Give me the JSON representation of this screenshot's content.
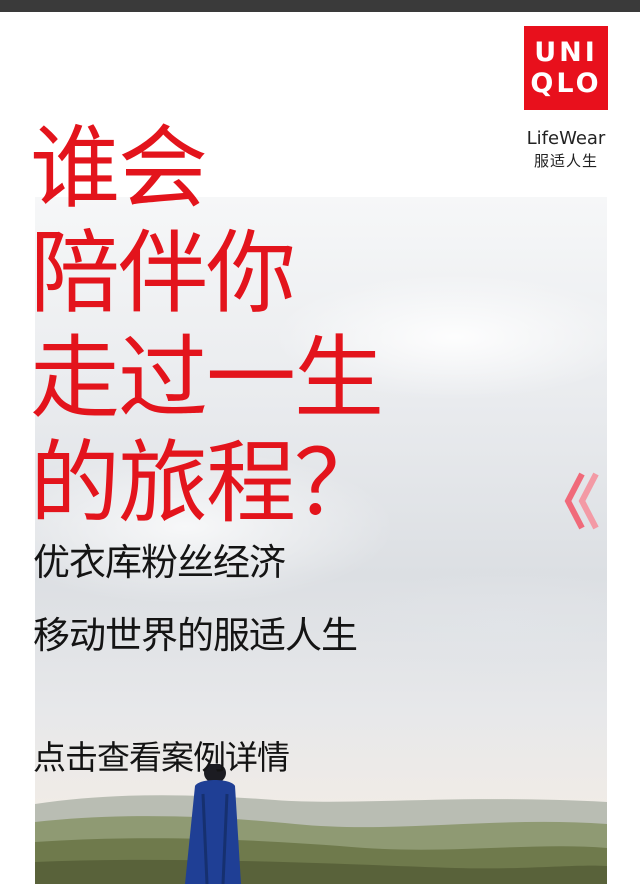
{
  "brand": {
    "logo_line1": "UNI",
    "logo_line2": "QLO",
    "tagline_en": "LifeWear",
    "tagline_cn": "服适人生"
  },
  "headline": {
    "line1": "谁会",
    "line2": "陪伴你",
    "line3": "走过一生",
    "line4": "的旅程？"
  },
  "subtitle": {
    "line1": "优衣库粉丝经济",
    "line2": "移动世界的服适人生"
  },
  "cta": {
    "label": "点击查看案例详情"
  },
  "icons": {
    "next": "double-chevron-left-icon"
  },
  "colors": {
    "brand_red": "#e8101c",
    "headline_red": "#e3141c",
    "text_dark": "#141414",
    "arrow_pink": "#f06a7a"
  }
}
